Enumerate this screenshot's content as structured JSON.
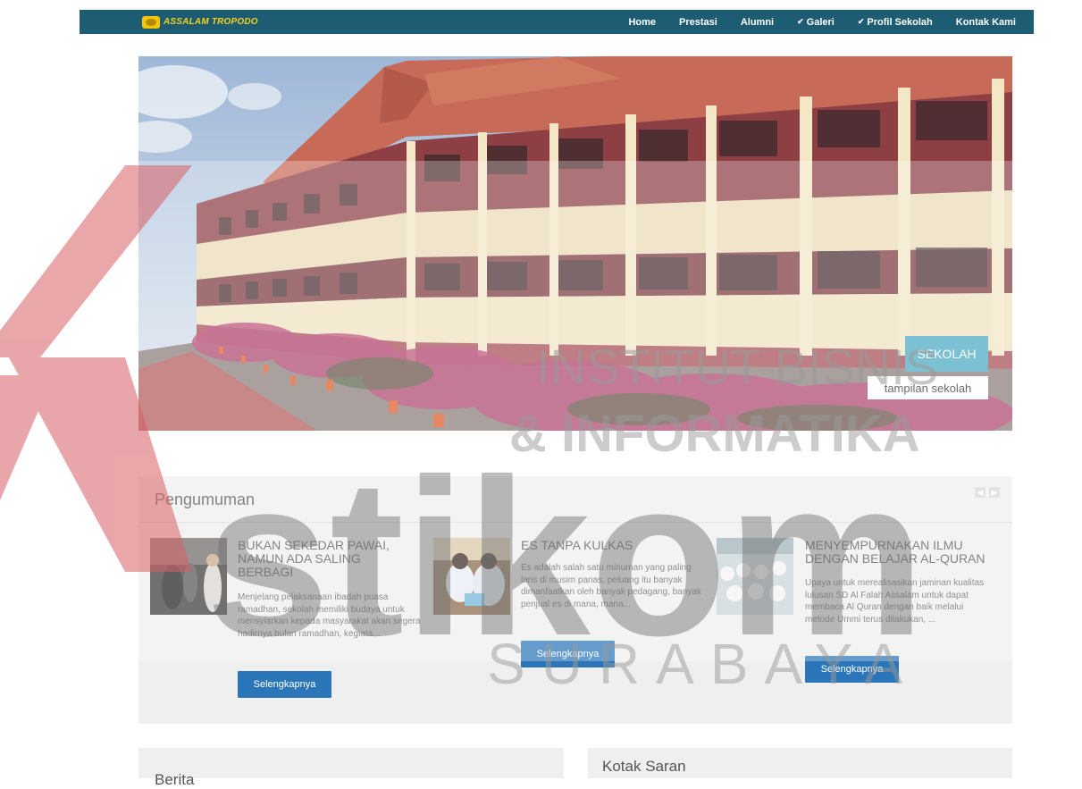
{
  "brand": {
    "name": "ASSALAM TROPODO"
  },
  "nav": {
    "items": [
      {
        "label": "Home",
        "dropdown": false
      },
      {
        "label": "Prestasi",
        "dropdown": false
      },
      {
        "label": "Alumni",
        "dropdown": false
      },
      {
        "label": "Galeri",
        "dropdown": true
      },
      {
        "label": "Profil Sekolah",
        "dropdown": true
      },
      {
        "label": "Kontak Kami",
        "dropdown": false
      }
    ]
  },
  "hero": {
    "title": "SEKOLAH",
    "caption": "tampilan sekolah"
  },
  "announcements": {
    "heading": "Pengumuman",
    "items": [
      {
        "title": "BUKAN SEKEDAR PAWAI, NAMUN ADA SALING BERBAGI",
        "excerpt": "Menjelang pelaksanaan ibadah puasa ramadhan, sekolah memiliki budaya untuk mensyiarkan kepada masyarakat akan segera hadirnya bulan ramadhan, kegiata...",
        "button": "Selengkapnya"
      },
      {
        "title": "ES TANPA KULKAS",
        "excerpt": "Es adalah salah satu minuman yang paling laris di musim panas, peluang itu banyak dimanfaatkan oleh banyak pedagang, banyak penjual es di mana, mana...",
        "button": "Selengkapnya"
      },
      {
        "title": "MENYEMPURNAKAN ILMU DENGAN BELAJAR AL-QURAN",
        "excerpt": "Upaya untuk merealisasikan jaminan kualitas lulusan SD Al Falah Assalam untuk dapat membaca Al Quran dengan baik melalui metode Ummi terus dilakukan, ...",
        "button": "Selengkapnya"
      }
    ]
  },
  "sections": {
    "berita": "Berita",
    "kotak_saran": "Kotak Saran"
  },
  "watermark": {
    "line1": "INSTITUT BISNIS",
    "line2": "& INFORMATIKA",
    "main": "stikom",
    "city": "SURABAYA"
  },
  "colors": {
    "nav_bg": "#1d5c73",
    "brand_text": "#f5d21a",
    "button": "#2b76b9",
    "hero_title_bg": "#4aa9c3",
    "watermark_red": "#c8202a"
  }
}
